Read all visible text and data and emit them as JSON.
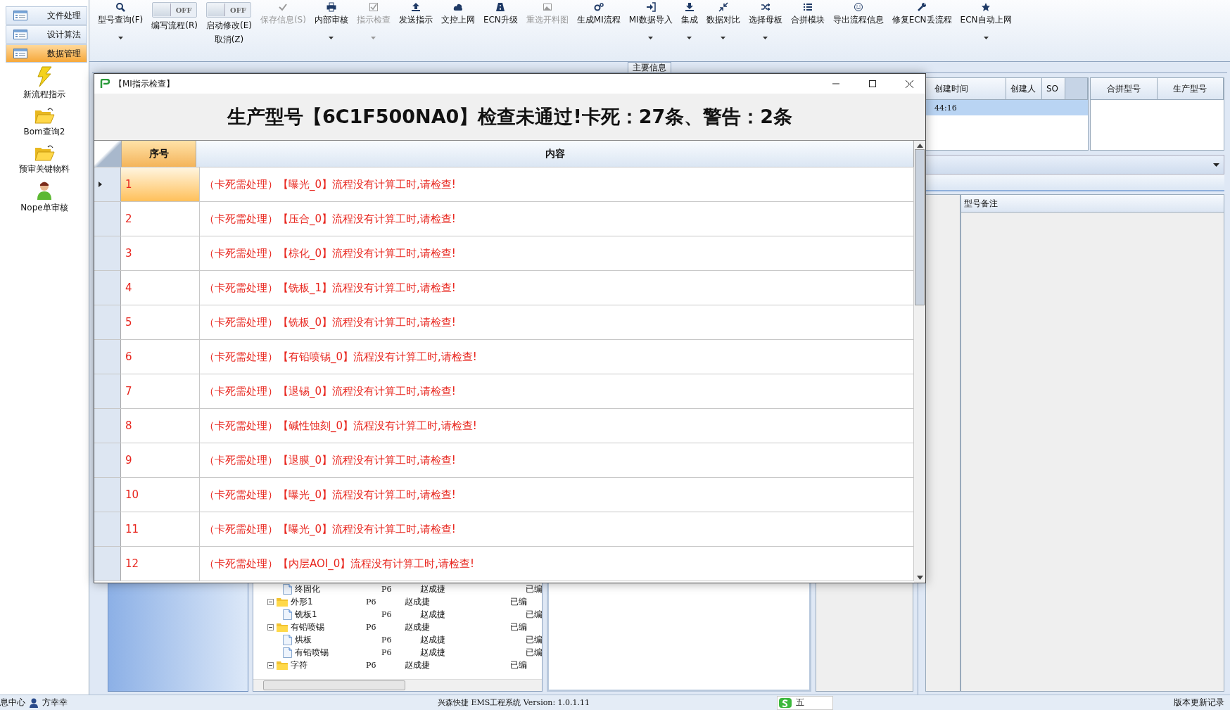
{
  "sidebar": {
    "nav": [
      {
        "label": "文件处理",
        "selected": false
      },
      {
        "label": "设计算法",
        "selected": false
      },
      {
        "label": "数据管理",
        "selected": true
      }
    ],
    "tools": [
      {
        "label": "新流程指示"
      },
      {
        "label": "Bom查询2"
      },
      {
        "label": "预审关键物料"
      },
      {
        "label": "Nope单审核"
      }
    ]
  },
  "toolbar": {
    "items": [
      {
        "kind": "button",
        "label": "型号查询(F)",
        "disabled": false,
        "dropdown": true
      },
      {
        "kind": "toggle",
        "toggle_text": "OFF",
        "on": false,
        "label": "编写流程(R)"
      },
      {
        "kind": "toggle",
        "toggle_text": "OFF",
        "on": false,
        "label": "启动修改(E)",
        "label_2": "取消(Z)"
      },
      {
        "kind": "button",
        "label": "保存信息(S)",
        "disabled": true,
        "dropdown": false
      },
      {
        "kind": "button",
        "label": "内部审核",
        "disabled": false,
        "dropdown": true
      },
      {
        "kind": "button",
        "label": "指示检查",
        "disabled": true,
        "dropdown": true
      },
      {
        "kind": "button",
        "label": "发送指示",
        "disabled": false,
        "dropdown": false
      },
      {
        "kind": "button",
        "label": "文控上网",
        "disabled": false,
        "dropdown": false
      },
      {
        "kind": "button",
        "label": "ECN升级",
        "disabled": false,
        "dropdown": false
      },
      {
        "kind": "button",
        "label": "重选开料图",
        "disabled": true,
        "dropdown": false
      },
      {
        "kind": "button",
        "label": "生成MI流程",
        "disabled": false,
        "dropdown": false
      },
      {
        "kind": "button",
        "label": "MI数据导入",
        "disabled": false,
        "dropdown": true
      },
      {
        "kind": "button",
        "label": "集成",
        "disabled": false,
        "dropdown": true
      },
      {
        "kind": "button",
        "label": "数据对比",
        "disabled": false,
        "dropdown": true
      },
      {
        "kind": "button",
        "label": "选择母板",
        "disabled": false,
        "dropdown": true
      },
      {
        "kind": "button",
        "label": "合拼模块",
        "disabled": false,
        "dropdown": false
      },
      {
        "kind": "button",
        "label": "导出流程信息",
        "disabled": false,
        "dropdown": false
      },
      {
        "kind": "button",
        "label": "修复ECN丢流程",
        "disabled": false,
        "dropdown": false
      },
      {
        "kind": "button",
        "label": "ECN自动上网",
        "disabled": false,
        "dropdown": true
      }
    ]
  },
  "main_tab": "主要信息",
  "record_table": {
    "columns": [
      "创建时间",
      "创建人",
      "SO"
    ],
    "rows": [
      {
        "time": "44:16",
        "selected": true
      }
    ]
  },
  "merge_table": {
    "columns": [
      "合拼型号",
      "生产型号"
    ]
  },
  "notes_panel": {
    "column": "型号备注"
  },
  "tree": {
    "leading_children": [
      {
        "kind": "file",
        "name": "终固化",
        "layer": "P6",
        "person": "赵成捷",
        "status": "已编"
      }
    ],
    "nodes": [
      {
        "kind": "folder",
        "name": "外形1",
        "expanded": true,
        "layer": "P6",
        "person": "赵成捷",
        "status": "已编",
        "children": [
          {
            "kind": "file",
            "name": "铣板1",
            "layer": "P6",
            "person": "赵成捷",
            "status": "已编"
          }
        ]
      },
      {
        "kind": "folder",
        "name": "有铅喷锡",
        "expanded": true,
        "layer": "P6",
        "person": "赵成捷",
        "status": "已编",
        "children": [
          {
            "kind": "file",
            "name": "烘板",
            "layer": "P6",
            "person": "赵成捷",
            "status": "已编"
          },
          {
            "kind": "file",
            "name": "有铅喷锡",
            "layer": "P6",
            "person": "赵成捷",
            "status": "已编"
          }
        ]
      },
      {
        "kind": "folder",
        "name": "字符",
        "expanded": true,
        "layer": "P6",
        "person": "赵成捷",
        "status": "已编"
      }
    ]
  },
  "dialog": {
    "title": "【MI指示检查】",
    "heading": "生产型号【6C1F500NA0】检查未通过!卡死：27条、警告：2条",
    "columns": [
      "序号",
      "内容"
    ],
    "rows": [
      {
        "no": "1",
        "content": "（卡死需处理）【曝光_0】流程没有计算工时,请检查!",
        "selected": true
      },
      {
        "no": "2",
        "content": "（卡死需处理）【压合_0】流程没有计算工时,请检查!",
        "selected": false
      },
      {
        "no": "3",
        "content": "（卡死需处理）【棕化_0】流程没有计算工时,请检查!",
        "selected": false
      },
      {
        "no": "4",
        "content": "（卡死需处理）【铣板_1】流程没有计算工时,请检查!",
        "selected": false
      },
      {
        "no": "5",
        "content": "（卡死需处理）【铣板_0】流程没有计算工时,请检查!",
        "selected": false
      },
      {
        "no": "6",
        "content": "（卡死需处理）【有铅喷锡_0】流程没有计算工时,请检查!",
        "selected": false
      },
      {
        "no": "7",
        "content": "（卡死需处理）【退锡_0】流程没有计算工时,请检查!",
        "selected": false
      },
      {
        "no": "8",
        "content": "（卡死需处理）【碱性蚀刻_0】流程没有计算工时,请检查!",
        "selected": false
      },
      {
        "no": "9",
        "content": "（卡死需处理）【退膜_0】流程没有计算工时,请检查!",
        "selected": false
      },
      {
        "no": "10",
        "content": "（卡死需处理）【曝光_0】流程没有计算工时,请检查!",
        "selected": false
      },
      {
        "no": "11",
        "content": "（卡死需处理）【曝光_0】流程没有计算工时,请检查!",
        "selected": false
      },
      {
        "no": "12",
        "content": "（卡死需处理）【内层AOI_0】流程没有计算工时,请检查!",
        "selected": false
      }
    ]
  },
  "status_bar": {
    "left_text": "息中心",
    "user": "方幸幸",
    "center": "兴森快捷 EMS工程系统 Version: 1.0.1.11",
    "ime_text": "五",
    "right": "版本更新记录"
  }
}
